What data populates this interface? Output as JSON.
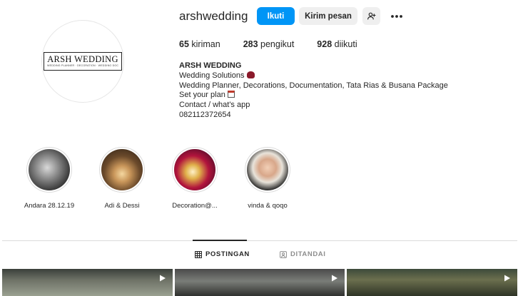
{
  "profile": {
    "username": "arshwedding",
    "avatar_logo_title": "ARSH WEDDING",
    "avatar_logo_subtitle": "WEDDING PLANNER · DECORATION · WEDDING DOCUMENTATION",
    "follow_label": "Ikuti",
    "message_label": "Kirim pesan",
    "add_user_icon": "person-add-icon",
    "more_icon": "more-horizontal-icon"
  },
  "stats": {
    "posts_count": "65",
    "posts_label": "kiriman",
    "followers_count": "283",
    "followers_label": "pengikut",
    "following_count": "928",
    "following_label": "diikuti"
  },
  "bio": {
    "name": "ARSH WEDDING",
    "line1": "Wedding Solutions",
    "line2": "Wedding Planner, Decorations, Documentation, Tata Rias & Busana Package",
    "line3": "Set your plan",
    "line4": "Contact / what's app",
    "line5": "082112372654"
  },
  "highlights": [
    {
      "label": "Andara 28.12.19"
    },
    {
      "label": "Adi & Dessi"
    },
    {
      "label": "Decoration@..."
    },
    {
      "label": "vinda & qoqo"
    }
  ],
  "tabs": {
    "posts_label": "POSTINGAN",
    "tagged_label": "DITANDAI"
  },
  "colors": {
    "accent": "#0095f6",
    "secondary_button": "#efefef",
    "text": "#262626",
    "muted": "#8e8e8e"
  }
}
